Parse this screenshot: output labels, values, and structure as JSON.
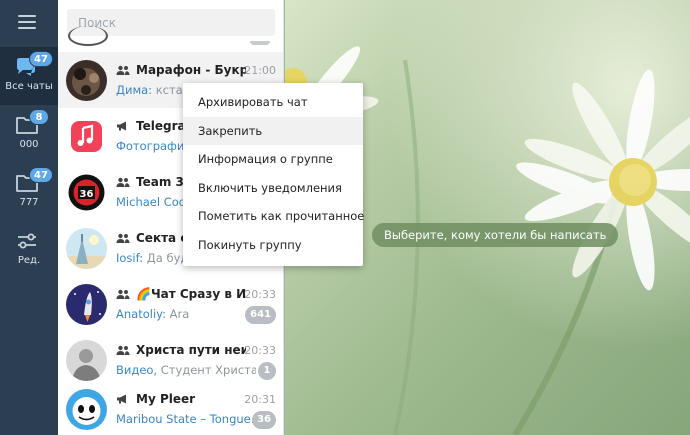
{
  "sidebar": {
    "folders": [
      {
        "label": "Все чаты",
        "badge": "47",
        "icon": "chat-bubbles-icon",
        "active": true
      },
      {
        "label": "000",
        "badge": "8",
        "icon": "folder-icon",
        "active": false
      },
      {
        "label": "777",
        "badge": "47",
        "icon": "folder-icon",
        "active": false
      },
      {
        "label": "Ред.",
        "badge": "",
        "icon": "sliders-icon",
        "active": false
      }
    ]
  },
  "search": {
    "placeholder": "Поиск"
  },
  "chats": [
    {
      "type": "group",
      "title": "Марафон - Букреев",
      "time": "21:00",
      "sender": "Дима:",
      "preview": " кстати",
      "badge": ""
    },
    {
      "type": "channel",
      "title": "Telegram",
      "time": "",
      "sender": "Фотография",
      "preview": "",
      "badge": ""
    },
    {
      "type": "group",
      "title": "Team 36",
      "time": "",
      "sender": "Michael Cook",
      "preview": "",
      "badge": ""
    },
    {
      "type": "group",
      "title": "Секта св",
      "time": "",
      "sender": "Iosif:",
      "preview": " Да буде",
      "badge": ""
    },
    {
      "type": "group",
      "title": "🌈Чат Сразу в И...",
      "time": "20:33",
      "sender": "Anatoliy:",
      "preview": " Ara",
      "badge": "641"
    },
    {
      "type": "group",
      "title": "Христа пути неи...",
      "time": "20:33",
      "sender": "Видео,",
      "preview": " Студент  Христа ...",
      "badge": "1"
    },
    {
      "type": "channel",
      "title": "My Pleer",
      "time": "20:31",
      "sender": "Maribou State – Tongue...",
      "preview": "",
      "badge": "36"
    }
  ],
  "context_menu": {
    "items": [
      "Архивировать чат",
      "Закрепить",
      "Информация о группе",
      "Включить уведомления",
      "Пометить как прочитанное",
      "Покинуть группу"
    ]
  },
  "main": {
    "hint": "Выберите, кому хотели бы написать"
  }
}
